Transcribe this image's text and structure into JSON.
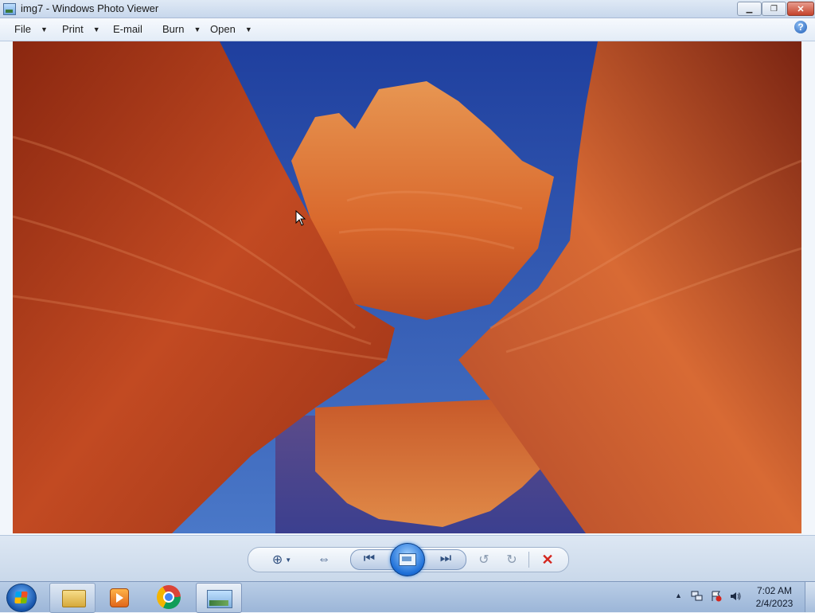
{
  "window": {
    "title": "img7 - Windows Photo Viewer",
    "controls": {
      "minimize": "minimize",
      "maximize": "restore",
      "close": "close"
    }
  },
  "menu": {
    "items": [
      {
        "label": "File",
        "has_dropdown": true
      },
      {
        "label": "Print",
        "has_dropdown": true
      },
      {
        "label": "E-mail",
        "has_dropdown": false
      },
      {
        "label": "Burn",
        "has_dropdown": true
      },
      {
        "label": "Open",
        "has_dropdown": true
      }
    ],
    "help_label": "?"
  },
  "photo": {
    "subject": "red sandstone canyon reflected in water under blue sky"
  },
  "controls": {
    "icons": [
      "zoom-icon",
      "fit-window-icon",
      "previous-icon",
      "slideshow-icon",
      "next-icon",
      "rotate-counterclockwise-icon",
      "rotate-clockwise-icon",
      "delete-icon"
    ]
  },
  "taskbar": {
    "apps": [
      "start-orb",
      "windows-explorer",
      "windows-media-player",
      "google-chrome",
      "windows-photo-viewer"
    ],
    "active_app": "windows-photo-viewer",
    "clock": {
      "time": "7:02 AM",
      "date": "2/4/2023"
    }
  },
  "colors": {
    "close_button": "#c5432c",
    "delete_icon": "#d4261e",
    "slideshow_button": "#1d6fd8"
  }
}
